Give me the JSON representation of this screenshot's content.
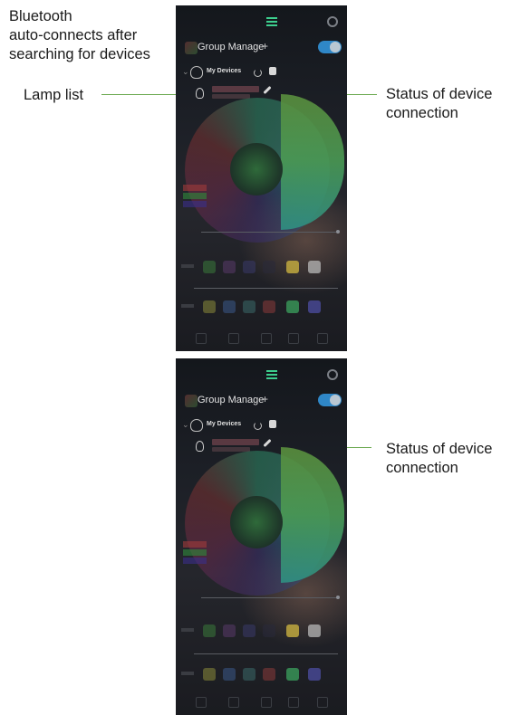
{
  "annotations": {
    "bluetooth_lines": [
      "Bluetooth",
      "auto-connects after",
      "searching for devices"
    ],
    "lamp_list": "Lamp list",
    "status_top_lines": [
      "Status of device",
      "connection"
    ],
    "status_bottom_lines": [
      "Status of device",
      "connection"
    ]
  },
  "phone": {
    "group_manage": "Group Manage",
    "plus": "+",
    "my_devices": "My Devices",
    "toggle_on": true
  },
  "colors": {
    "annotation_line": "#6aa84f",
    "accent_green": "#3dcf8e",
    "toggle_blue": "#2f87c7"
  },
  "icons": [
    "list-icon",
    "gear-icon",
    "plus-icon",
    "toggle",
    "bulbs-icon",
    "refresh-icon",
    "lock-icon",
    "lamp-bulb-icon",
    "link-icon"
  ]
}
